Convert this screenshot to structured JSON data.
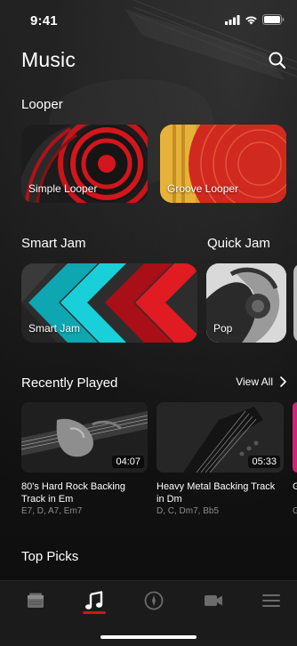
{
  "status": {
    "time": "9:41"
  },
  "header": {
    "title": "Music"
  },
  "looper": {
    "title": "Looper",
    "cards": [
      {
        "label": "Simple Looper"
      },
      {
        "label": "Groove Looper"
      }
    ]
  },
  "smart_jam": {
    "title": "Smart Jam",
    "card_label": "Smart Jam"
  },
  "quick_jam": {
    "title": "Quick Jam",
    "card_label": "Pop"
  },
  "recently_played": {
    "title": "Recently Played",
    "view_all": "View All",
    "tracks": [
      {
        "title": "80's Hard Rock Backing Track in Em",
        "chords": "E7, D, A7, Em7",
        "duration": "04:07"
      },
      {
        "title": "Heavy Metal Backing Track in Dm",
        "chords": "D, C, Dm7, Bb5",
        "duration": "05:33"
      },
      {
        "title": "G",
        "chords": "G"
      }
    ]
  },
  "top_picks": {
    "title": "Top Picks"
  },
  "nav": {
    "items": [
      {
        "icon": "amp-icon",
        "active": false
      },
      {
        "icon": "music-note-icon",
        "active": true
      },
      {
        "icon": "compass-icon",
        "active": false
      },
      {
        "icon": "video-camera-icon",
        "active": false
      },
      {
        "icon": "menu-icon",
        "active": false
      }
    ]
  },
  "colors": {
    "accent": "#d4141c",
    "background": "#111111",
    "muted_text": "#8c8c8c"
  }
}
